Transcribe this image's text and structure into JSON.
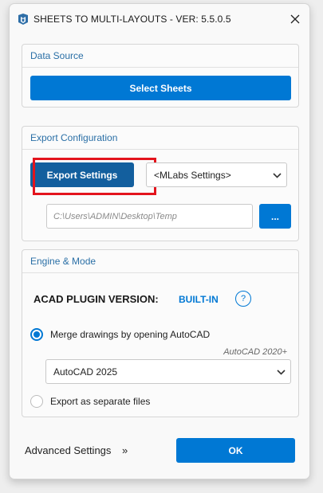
{
  "window": {
    "title": "SHEETS TO MULTI-LAYOUTS - VER: 5.5.0.5"
  },
  "data_source": {
    "header": "Data Source",
    "select_sheets_label": "Select Sheets"
  },
  "export_config": {
    "header": "Export Configuration",
    "export_settings_label": "Export Settings",
    "settings_dropdown_value": "<MLabs Settings>",
    "path_value": "C:\\Users\\ADMIN\\Desktop\\Temp",
    "browse_label": "..."
  },
  "engine_mode": {
    "header": "Engine & Mode",
    "acad_plugin_label": "ACAD PLUGIN VERSION:",
    "acad_plugin_value": "BUILT-IN",
    "help_label": "?",
    "merge_option_label": "Merge drawings by opening AutoCAD",
    "merge_selected": true,
    "autocad_version_hint": "AutoCAD 2020+",
    "autocad_dropdown_value": "AutoCAD 2025",
    "separate_option_label": "Export as separate files",
    "separate_selected": false
  },
  "footer": {
    "advanced_label": "Advanced Settings",
    "advanced_chevron": "»",
    "ok_label": "OK"
  },
  "colors": {
    "accent": "#0078d4",
    "accent_dark": "#135f9e",
    "highlight": "#e3141d",
    "header_text": "#2a6fa6"
  }
}
